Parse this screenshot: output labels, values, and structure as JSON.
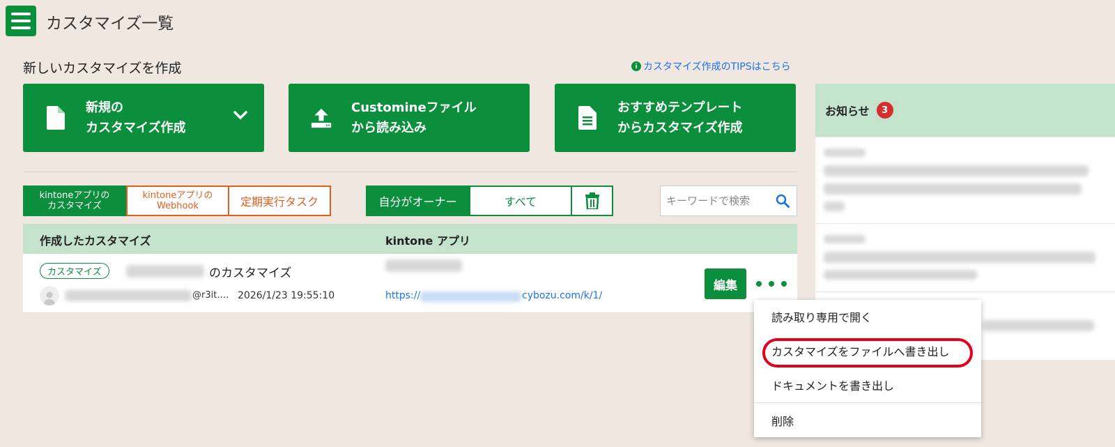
{
  "header": {
    "title": "カスタマイズ一覧",
    "menu_icon": "hamburger-icon"
  },
  "create_section": {
    "heading": "新しいカスタマイズを作成",
    "tips_link": "カスタマイズ作成のTIPSはこちら",
    "tips_icon": "info-icon",
    "buttons": [
      {
        "label": "新規の\nカスタマイズ作成",
        "icon": "file-icon",
        "has_dropdown": true
      },
      {
        "label": "Customineファイル\nから読み込み",
        "icon": "upload-icon"
      },
      {
        "label": "おすすめテンプレート\nからカスタマイズ作成",
        "icon": "document-icon"
      }
    ]
  },
  "tabs": [
    {
      "label": "kintoneアプリの\nカスタマイズ",
      "active": true
    },
    {
      "label": "kintoneアプリの\nWebhook",
      "active": false
    },
    {
      "label": "定期実行タスク",
      "active": false
    }
  ],
  "owner_filter": {
    "options": [
      "自分がオーナー",
      "すべて"
    ],
    "selected": "自分がオーナー",
    "trash_icon": "trash-icon"
  },
  "search": {
    "placeholder": "キーワードで検索",
    "icon": "search-icon"
  },
  "table": {
    "columns": [
      "作成したカスタマイズ",
      "kintone アプリ"
    ],
    "rows": [
      {
        "badge": "カスタマイズ",
        "name_suffix": "のカスタマイズ",
        "owner_domain": "@r3it.…",
        "created_at": "2026/1/23 19:55:10",
        "url_prefix": "https://",
        "url_suffix": "cybozu.com/k/1/",
        "edit_label": "編集"
      }
    ]
  },
  "notice": {
    "title": "お知らせ",
    "count": "3"
  },
  "dropdown_menu": {
    "items": [
      "読み取り専用で開く",
      "カスタマイズをファイルへ書き出し",
      "ドキュメントを書き出し",
      "削除"
    ],
    "highlighted_index": 1
  },
  "colors": {
    "primary_green": "#0b8f3c",
    "light_green": "#c4e3cc",
    "orange": "#e05f1f",
    "background": "#f0e7e1",
    "highlight_red": "#e3001b"
  }
}
